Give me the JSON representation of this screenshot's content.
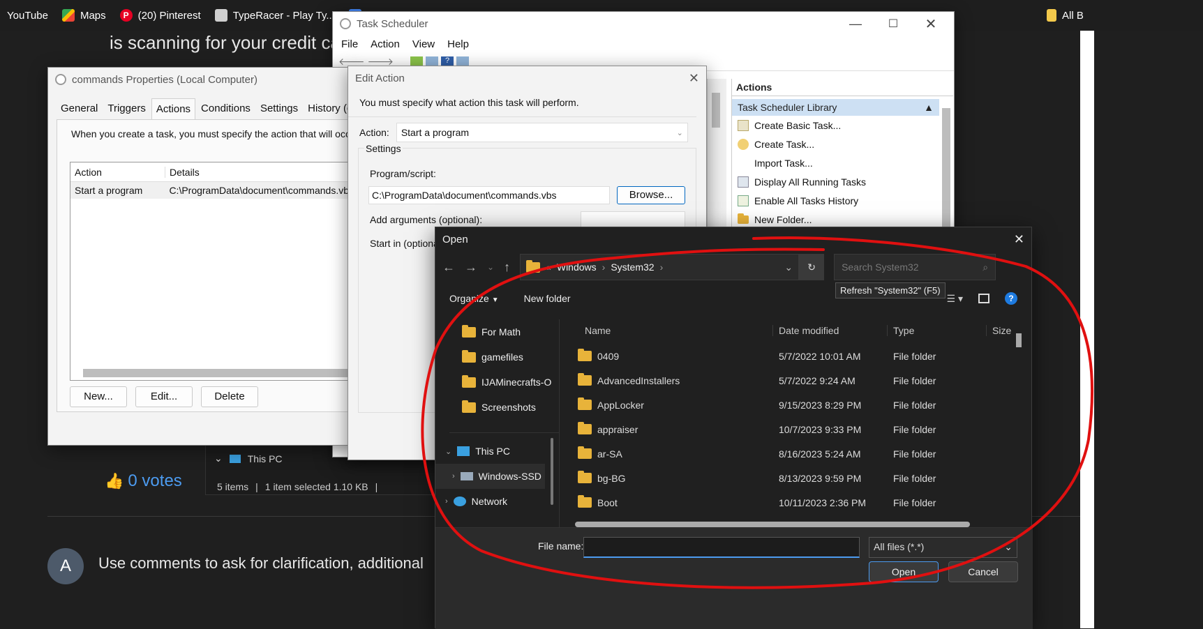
{
  "bookmarks": [
    {
      "label": "YouTube",
      "icon": "youtube-icon"
    },
    {
      "label": "Maps",
      "icon": "maps-icon"
    },
    {
      "label": "(20) Pinterest",
      "icon": "pinterest-icon"
    },
    {
      "label": "TypeRacer - Play Ty...",
      "icon": "typeracer-icon"
    },
    {
      "label": "",
      "icon": "docs-icon"
    },
    {
      "label": "All B",
      "icon": "bookmark-folder-icon"
    }
  ],
  "background_page": {
    "heading_fragment": "is scanning for your credit card r",
    "votes": "0 votes",
    "comment_avatar": "A",
    "comment_prompt": "Use comments to ask for clarification, additional"
  },
  "explorer_behind": {
    "this_pc": "This PC",
    "status_items": "5 items",
    "status_selected": "1 item selected  1.10 KB",
    "status_sep": "|"
  },
  "task_scheduler": {
    "title": "Task Scheduler",
    "menu": [
      "File",
      "Action",
      "View",
      "Help"
    ],
    "actions_header": "Actions",
    "library": "Task Scheduler Library",
    "items": [
      {
        "label": "Create Basic Task...",
        "icon": "create-basic-task-icon"
      },
      {
        "label": "Create Task...",
        "icon": "create-task-icon"
      },
      {
        "label": "Import Task...",
        "icon": ""
      },
      {
        "label": "Display All Running Tasks",
        "icon": "running-tasks-icon"
      },
      {
        "label": "Enable All Tasks History",
        "icon": "history-icon"
      },
      {
        "label": "New Folder...",
        "icon": "new-folder-icon"
      }
    ]
  },
  "properties": {
    "title": "commands Properties (Local Computer)",
    "tabs": [
      "General",
      "Triggers",
      "Actions",
      "Conditions",
      "Settings",
      "History (disable"
    ],
    "selected_tab": "Actions",
    "info": "When you create a task, you must specify the action that will occu",
    "columns": [
      "Action",
      "Details"
    ],
    "rows": [
      {
        "action": "Start a program",
        "details": "C:\\ProgramData\\document\\commands.vbs"
      }
    ],
    "buttons": [
      "New...",
      "Edit...",
      "Delete"
    ]
  },
  "edit_action": {
    "title": "Edit Action",
    "instruction": "You must specify what action this task will perform.",
    "action_label": "Action:",
    "action_value": "Start a program",
    "settings_label": "Settings",
    "program_label": "Program/script:",
    "program_value": "C:\\ProgramData\\document\\commands.vbs",
    "browse": "Browse...",
    "args_label": "Add arguments (optional):",
    "startin_label": "Start in (optiona"
  },
  "open_dialog": {
    "title": "Open",
    "breadcrumb": [
      "Windows",
      "System32"
    ],
    "search_placeholder": "Search System32",
    "refresh_tooltip": "Refresh \"System32\" (F5)",
    "organize": "Organize",
    "new_folder": "New folder",
    "nav": [
      {
        "label": "For Math",
        "type": "folder"
      },
      {
        "label": "gamefiles",
        "type": "folder"
      },
      {
        "label": "IJAMinecrafts-O",
        "type": "folder"
      },
      {
        "label": "Screenshots",
        "type": "folder"
      },
      {
        "label": "This PC",
        "type": "pc"
      },
      {
        "label": "Windows-SSD",
        "type": "drive"
      },
      {
        "label": "Network",
        "type": "network"
      }
    ],
    "columns": [
      "Name",
      "Date modified",
      "Type",
      "Size"
    ],
    "files": [
      {
        "name": "0409",
        "date": "5/7/2022 10:01 AM",
        "type": "File folder"
      },
      {
        "name": "AdvancedInstallers",
        "date": "5/7/2022 9:24 AM",
        "type": "File folder"
      },
      {
        "name": "AppLocker",
        "date": "9/15/2023 8:29 PM",
        "type": "File folder"
      },
      {
        "name": "appraiser",
        "date": "10/7/2023 9:33 PM",
        "type": "File folder"
      },
      {
        "name": "ar-SA",
        "date": "8/16/2023 5:24 AM",
        "type": "File folder"
      },
      {
        "name": "bg-BG",
        "date": "8/13/2023 9:59 PM",
        "type": "File folder"
      },
      {
        "name": "Boot",
        "date": "10/11/2023 2:36 PM",
        "type": "File folder"
      }
    ],
    "filename_label": "File name:",
    "filename_value": "",
    "filter": "All files (*.*)",
    "open_button": "Open",
    "cancel_button": "Cancel"
  },
  "colors": {
    "accent_blue": "#0067c0",
    "annotation_red": "#e01010",
    "folder_yellow": "#e8b33a"
  }
}
